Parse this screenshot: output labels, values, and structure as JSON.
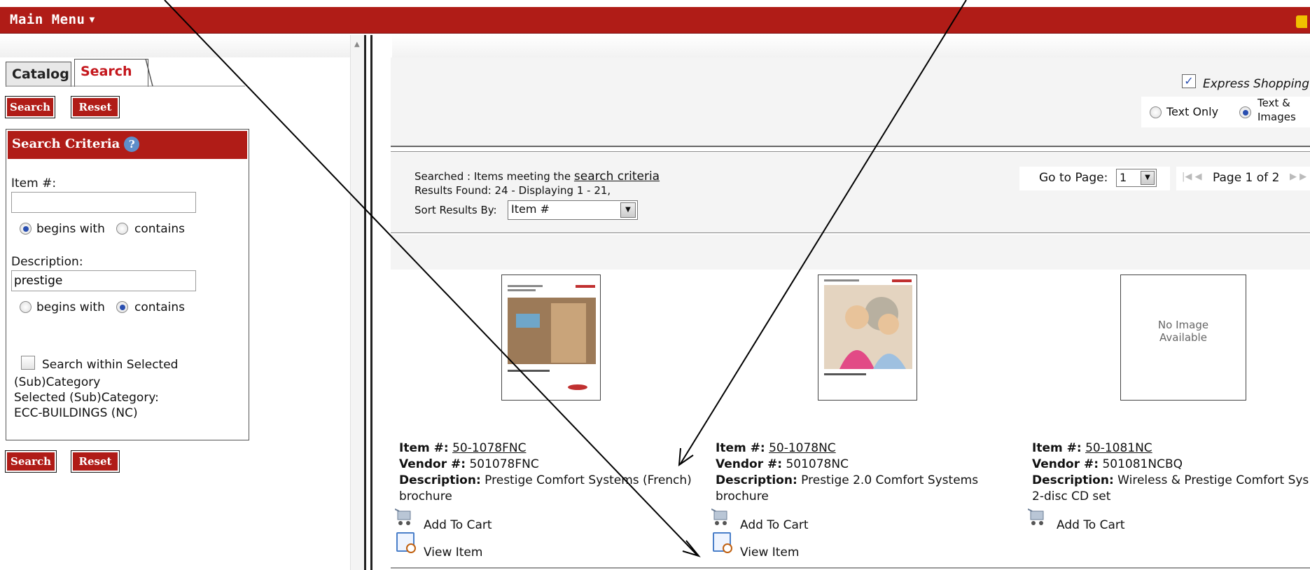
{
  "topbar": {
    "menu_label": "Main Menu"
  },
  "left": {
    "tabs": [
      {
        "label": "Catalog"
      },
      {
        "label": "Search"
      }
    ],
    "buttons": {
      "search": "Search",
      "reset": "Reset"
    },
    "criteria_title": "Search Criteria",
    "item_label": "Item #:",
    "item_value": "",
    "begins_with": "begins with",
    "contains": "contains",
    "description_label": "Description:",
    "description_value": "prestige",
    "search_within": "Search within Selected",
    "subcategory": "(Sub)Category",
    "selected_subcategory": "Selected (Sub)Category:",
    "selected_value": "ECC-BUILDINGS (NC)"
  },
  "express": {
    "label": "Express Shopping",
    "text_only": "Text Only",
    "text_images_1": "Text &",
    "text_images_2": "Images"
  },
  "results": {
    "searched_prefix": "Searched : Items meeting the ",
    "searched_link": "search criteria",
    "results_found": "Results Found: 24 - Displaying 1 - 21,",
    "sort_label": "Sort Results By:",
    "sort_value": "Item #",
    "goto_label": "Go to Page:",
    "goto_value": "1",
    "page_info": "Page 1 of 2"
  },
  "products": [
    {
      "item_label": "Item #:",
      "item": "50-1078FNC",
      "vendor_label": "Vendor #:",
      "vendor": "501078FNC",
      "desc_label": "Description:",
      "desc_1": "Prestige Comfort Systems (French)",
      "desc_2": "brochure",
      "add_to_cart": "Add To Cart",
      "view_item": "View Item"
    },
    {
      "item_label": "Item #:",
      "item": "50-1078NC",
      "vendor_label": "Vendor #:",
      "vendor": "501078NC",
      "desc_label": "Description:",
      "desc_1": "Prestige 2.0 Comfort Systems",
      "desc_2": "brochure",
      "add_to_cart": "Add To Cart",
      "view_item": "View Item"
    },
    {
      "item_label": "Item #:",
      "item": "50-1081NC",
      "vendor_label": "Vendor #:",
      "vendor": "501081NCBQ",
      "desc_label": "Description:",
      "desc_1": "Wireless & Prestige Comfort Sys",
      "desc_2": "2-disc CD set",
      "add_to_cart": "Add To Cart"
    }
  ],
  "no_image": {
    "line1": "No Image",
    "line2": "Available"
  },
  "colors": {
    "brand_red": "#b01c17",
    "link": "#111111"
  }
}
